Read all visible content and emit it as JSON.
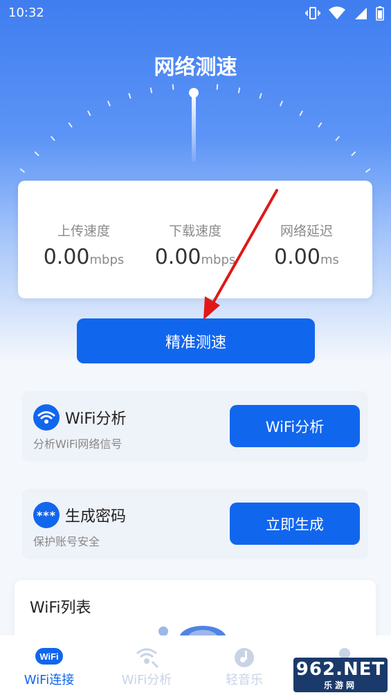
{
  "status_bar": {
    "time": "10:32"
  },
  "header": {
    "title": "网络测速"
  },
  "stats": [
    {
      "label": "上传速度",
      "value": "0.00",
      "unit": "mbps"
    },
    {
      "label": "下载速度",
      "value": "0.00",
      "unit": "mbps"
    },
    {
      "label": "网络延迟",
      "value": "0.00",
      "unit": "ms"
    }
  ],
  "test_button": {
    "label": "精准测速"
  },
  "features": [
    {
      "title": "WiFi分析",
      "desc": "分析WiFi网络信号",
      "button": "WiFi分析",
      "icon": "wifi-icon"
    },
    {
      "title": "生成密码",
      "desc": "保护账号安全",
      "button": "立即生成",
      "icon": "password-dots-icon"
    }
  ],
  "wifi_list": {
    "title": "WiFi列表"
  },
  "tabs": [
    {
      "label": "WiFi连接",
      "icon": "wifi-badge-icon",
      "active": true
    },
    {
      "label": "WiFi分析",
      "icon": "wifi-search-icon",
      "active": false
    },
    {
      "label": "轻音乐",
      "icon": "music-icon",
      "active": false
    },
    {
      "label": "",
      "icon": "profile-icon",
      "active": false
    }
  ],
  "watermark": {
    "text": "962.NET",
    "sub": "乐游网"
  },
  "colors": {
    "accent": "#1166ee",
    "inactive": "#c8d3e6"
  }
}
